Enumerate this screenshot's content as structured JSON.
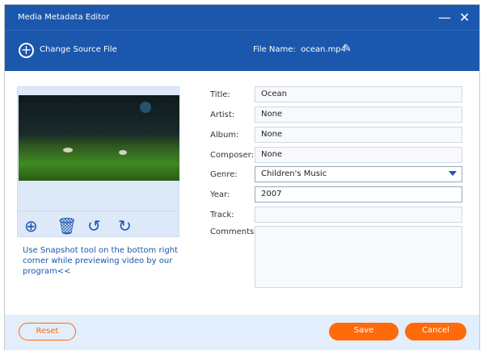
{
  "window": {
    "title": "Media Metadata Editor"
  },
  "toolbar": {
    "change_source": "Change Source File",
    "file_name_label": "File Name:",
    "file_name": "ocean.mp4"
  },
  "hint": "Use Snapshot tool on the bottom right corner while previewing video by our program<<",
  "fields": {
    "title": {
      "label": "Title:",
      "value": "Ocean"
    },
    "artist": {
      "label": "Artist:",
      "value": "None"
    },
    "album": {
      "label": "Album:",
      "value": "None"
    },
    "composer": {
      "label": "Composer:",
      "value": "None"
    },
    "genre": {
      "label": "Genre:",
      "value": "Children's Music"
    },
    "year": {
      "label": "Year:",
      "value": "2007"
    },
    "track": {
      "label": "Track:",
      "value": ""
    },
    "comments": {
      "label": "Comments:",
      "value": ""
    }
  },
  "footer": {
    "reset": "Reset",
    "save": "Save",
    "cancel": "Cancel"
  },
  "colors": {
    "header": "#1b57ad",
    "accent": "#ff6a0a"
  }
}
